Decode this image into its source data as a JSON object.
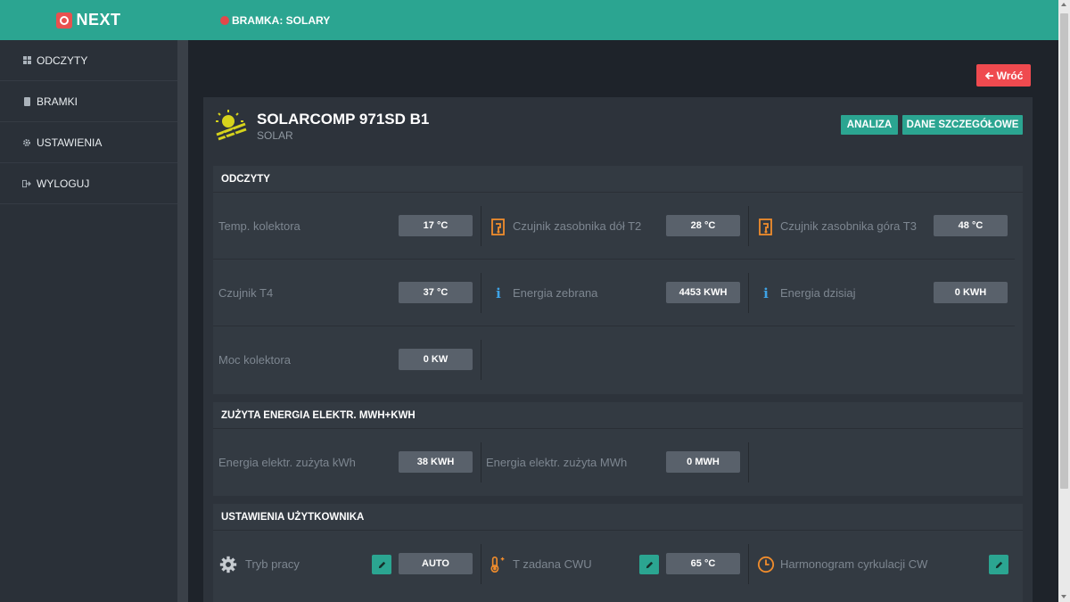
{
  "app": {
    "logo_text": "NEXT"
  },
  "colors": {
    "accent": "#2ba591",
    "danger": "#ef4a4f",
    "sidebar": "#2a3038",
    "panel": "#333a42",
    "value_box": "#59616b",
    "orange_icon": "#f08c2c",
    "info_icon": "#3ea3e6"
  },
  "sidebar": {
    "items": [
      {
        "label": "ODCZYTY",
        "icon": "grid-icon"
      },
      {
        "label": "BRAMKI",
        "icon": "chip-icon"
      },
      {
        "label": "USTAWIENIA",
        "icon": "gear-icon"
      },
      {
        "label": "WYLOGUJ",
        "icon": "logout-icon"
      }
    ]
  },
  "topbar": {
    "title": "BRAMKA: SOLARY",
    "status_color": "#e2484a"
  },
  "back_button": {
    "label": "Wróć"
  },
  "device": {
    "name": "SOLARCOMP 971SD B1",
    "type": "SOLAR",
    "icon": "sun-icon",
    "buttons": {
      "analiza": "ANALIZA",
      "dane": "DANE SZCZEGÓŁOWE"
    }
  },
  "sections": {
    "odczyty": {
      "title": "ODCZYTY",
      "rows": [
        [
          {
            "label": "Temp. kolektora",
            "value": "17 °C",
            "icon": ""
          },
          {
            "label": "Czujnik zasobnika dół T2",
            "value": "28 °C",
            "icon": "tank-sensor-icon"
          },
          {
            "label": "Czujnik zasobnika góra T3",
            "value": "48 °C",
            "icon": "tank-sensor-icon"
          }
        ],
        [
          {
            "label": "Czujnik T4",
            "value": "37 °C",
            "icon": ""
          },
          {
            "label": "Energia zebrana",
            "value": "4453 KWH",
            "icon": "info-icon"
          },
          {
            "label": "Energia dzisiaj",
            "value": "0 KWH",
            "icon": "info-icon"
          }
        ],
        [
          {
            "label": "Moc kolektora",
            "value": "0 KW",
            "icon": ""
          }
        ]
      ]
    },
    "energia": {
      "title": "ZUŻYTA ENERGIA ELEKTR. MWH+KWH",
      "rows": [
        [
          {
            "label": "Energia elektr. zużyta kWh",
            "value": "38 KWH"
          },
          {
            "label": "Energia elektr. zużyta MWh",
            "value": "0 MWH"
          }
        ]
      ]
    },
    "ustawienia": {
      "title": "USTAWIENIA UŻYTKOWNIKA",
      "rows": [
        [
          {
            "label": "Tryb pracy",
            "value": "AUTO",
            "icon": "gear-icon"
          },
          {
            "label": "T zadana CWU",
            "value": "65 °C",
            "icon": "thermometer-icon"
          },
          {
            "label": "Harmonogram cyrkulacji CW",
            "icon": "clock-icon"
          }
        ]
      ]
    }
  }
}
